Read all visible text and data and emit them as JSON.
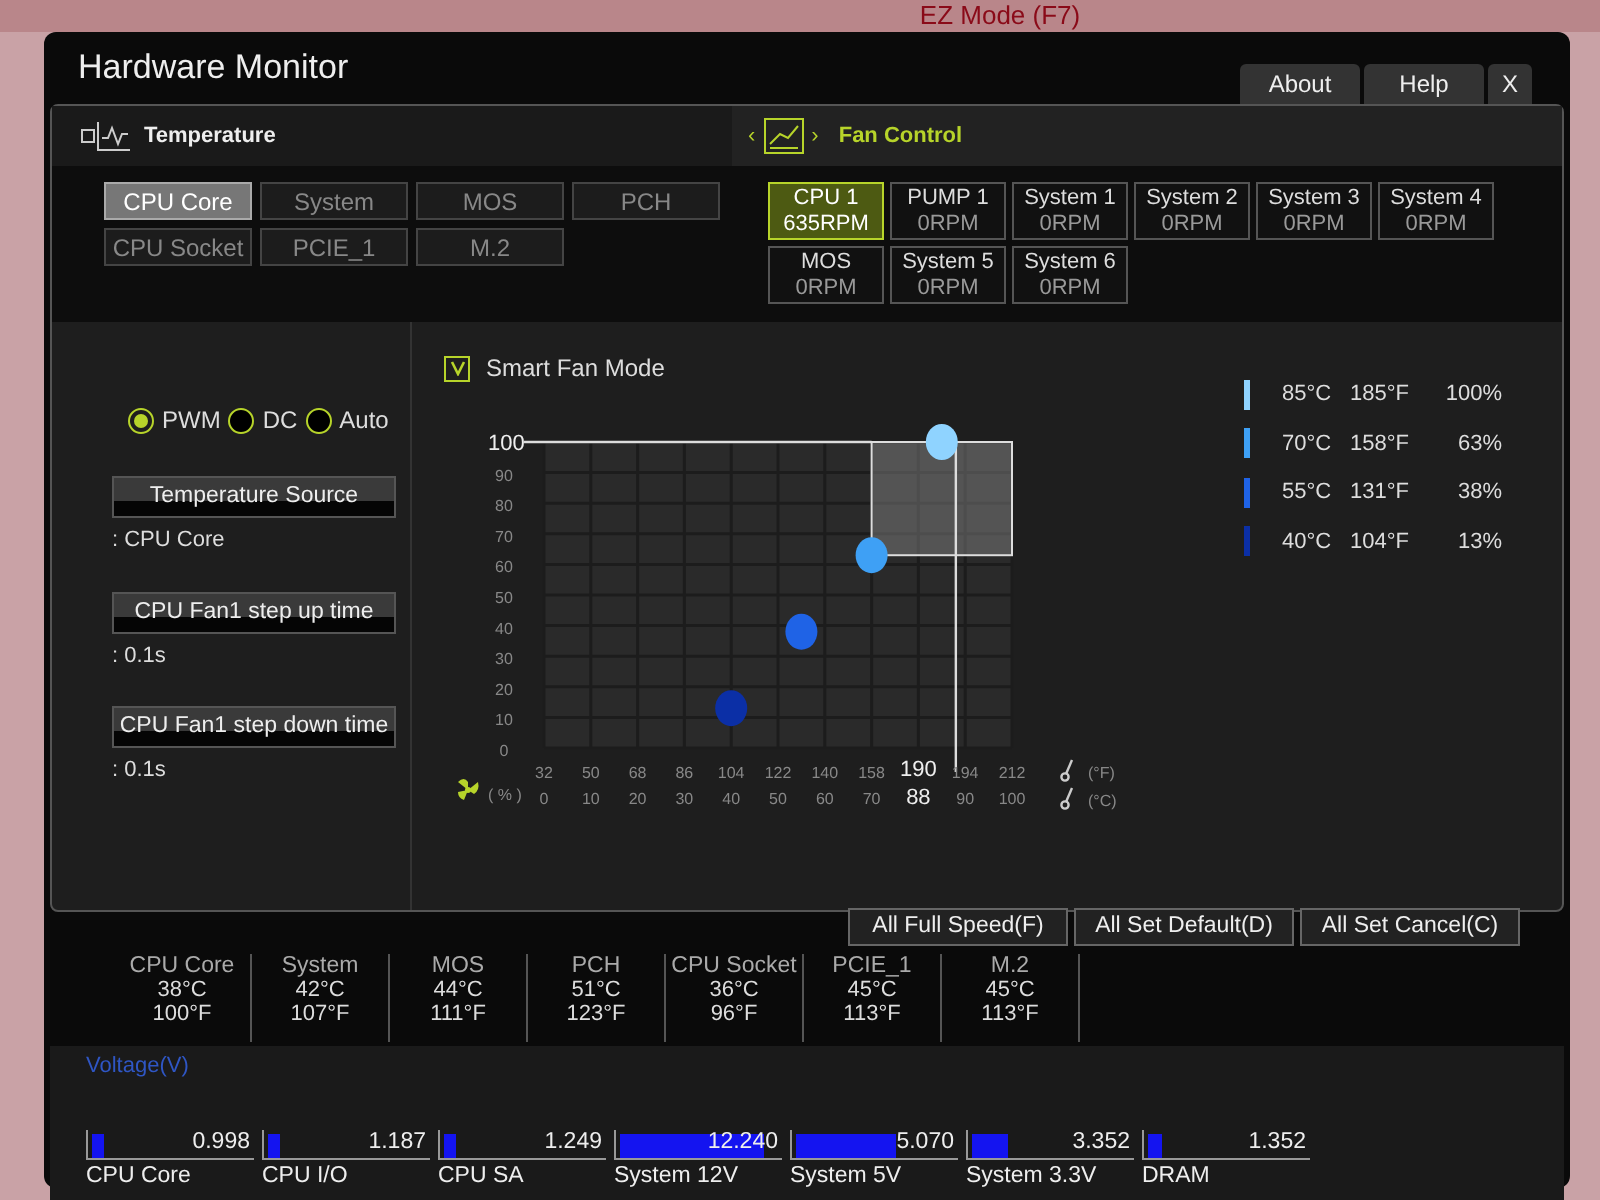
{
  "background": {
    "mode_label": "EZ Mode (F7)"
  },
  "window": {
    "title": "Hardware Monitor",
    "buttons": [
      "About",
      "Help",
      "X"
    ]
  },
  "temperature_panel": {
    "title": "Temperature",
    "sensors": [
      {
        "label": "CPU Core",
        "selected": true
      },
      {
        "label": "System",
        "selected": false
      },
      {
        "label": "MOS",
        "selected": false
      },
      {
        "label": "PCH",
        "selected": false
      },
      {
        "label": "CPU Socket",
        "selected": false
      },
      {
        "label": "PCIE_1",
        "selected": false
      },
      {
        "label": "M.2",
        "selected": false
      }
    ]
  },
  "fan_panel": {
    "title": "Fan Control",
    "prev": "‹",
    "next": "›",
    "fans": [
      {
        "name": "CPU 1",
        "rpm": "635RPM",
        "selected": true
      },
      {
        "name": "PUMP 1",
        "rpm": "0RPM",
        "selected": false
      },
      {
        "name": "System 1",
        "rpm": "0RPM",
        "selected": false
      },
      {
        "name": "System 2",
        "rpm": "0RPM",
        "selected": false
      },
      {
        "name": "System 3",
        "rpm": "0RPM",
        "selected": false
      },
      {
        "name": "System 4",
        "rpm": "0RPM",
        "selected": false
      },
      {
        "name": "MOS",
        "rpm": "0RPM",
        "selected": false
      },
      {
        "name": "System 5",
        "rpm": "0RPM",
        "selected": false
      },
      {
        "name": "System 6",
        "rpm": "0RPM",
        "selected": false
      }
    ]
  },
  "modes": [
    {
      "label": "PWM",
      "selected": true
    },
    {
      "label": "DC",
      "selected": false
    },
    {
      "label": "Auto",
      "selected": false
    }
  ],
  "settings": [
    {
      "button": "Temperature Source",
      "value": ": CPU Core"
    },
    {
      "button": "CPU Fan1 step up time",
      "value": ": 0.1s"
    },
    {
      "button": "CPU Fan1 step down time",
      "value": ": 0.1s"
    }
  ],
  "smart_fan_mode": {
    "label": "Smart Fan Mode",
    "checked": true
  },
  "fan_curve": {
    "fahrenheit_unit": "(°F)",
    "cursor_f": "190",
    "cursor_c": "88",
    "fahrenheit_ticks": [
      "32",
      "50",
      "68",
      "86",
      "104",
      "122",
      "140",
      "158",
      "194",
      "212"
    ],
    "chart_data": {
      "type": "scatter",
      "xlabel": "(°C)",
      "ylabel": "( % )",
      "x": [
        40,
        55,
        70,
        85
      ],
      "series": [
        {
          "color": "#0b2fa6",
          "values": [
            13,
            null,
            null,
            null
          ]
        },
        {
          "color": "#1f63e6",
          "values": [
            null,
            38,
            null,
            null
          ]
        },
        {
          "color": "#3ea0f5",
          "values": [
            null,
            null,
            63,
            null
          ]
        },
        {
          "color": "#8fd3ff",
          "values": [
            null,
            null,
            null,
            100
          ]
        }
      ],
      "grid": true,
      "ref_lines": [
        {
          "axis": "y",
          "value": 100
        },
        {
          "axis": "x",
          "value": 88
        }
      ],
      "bands": [
        {
          "axis": "x",
          "from": 70,
          "to": 100
        }
      ],
      "xlim": [
        0,
        100
      ],
      "ylim": [
        0,
        100
      ],
      "xticks": [
        0,
        10,
        20,
        30,
        40,
        50,
        60,
        70,
        90,
        100
      ],
      "yticks": [
        0,
        10,
        20,
        30,
        40,
        50,
        60,
        70,
        80,
        90,
        100
      ]
    }
  },
  "curve_points": [
    {
      "celsius": "85°C",
      "fahrenheit": "185°F",
      "percent": "100%",
      "color": "#8fd3ff"
    },
    {
      "celsius": "70°C",
      "fahrenheit": "158°F",
      "percent": "63%",
      "color": "#3ea0f5"
    },
    {
      "celsius": "55°C",
      "fahrenheit": "131°F",
      "percent": "38%",
      "color": "#1f63e6"
    },
    {
      "celsius": "40°C",
      "fahrenheit": "104°F",
      "percent": "13%",
      "color": "#0b2fa6"
    }
  ],
  "actions": [
    "All Full Speed(F)",
    "All Set Default(D)",
    "All Set Cancel(C)"
  ],
  "temperatures": [
    {
      "name": "CPU Core",
      "celsius": "38°C",
      "fahrenheit": "100°F"
    },
    {
      "name": "System",
      "celsius": "42°C",
      "fahrenheit": "107°F"
    },
    {
      "name": "MOS",
      "celsius": "44°C",
      "fahrenheit": "111°F"
    },
    {
      "name": "PCH",
      "celsius": "51°C",
      "fahrenheit": "123°F"
    },
    {
      "name": "CPU Socket",
      "celsius": "36°C",
      "fahrenheit": "96°F"
    },
    {
      "name": "PCIE_1",
      "celsius": "45°C",
      "fahrenheit": "113°F"
    },
    {
      "name": "M.2",
      "celsius": "45°C",
      "fahrenheit": "113°F"
    }
  ],
  "voltage": {
    "title": "Voltage(V)",
    "rails": [
      {
        "name": "CPU Core",
        "reading": "0.998",
        "level": 0.07
      },
      {
        "name": "CPU I/O",
        "reading": "1.187",
        "level": 0.08
      },
      {
        "name": "CPU SA",
        "reading": "1.249",
        "level": 0.08
      },
      {
        "name": "System 12V",
        "reading": "12.240",
        "level": 0.9
      },
      {
        "name": "System 5V",
        "reading": "5.070",
        "level": 0.62
      },
      {
        "name": "System 3.3V",
        "reading": "3.352",
        "level": 0.23
      },
      {
        "name": "DRAM",
        "reading": "1.352",
        "level": 0.09
      }
    ]
  }
}
